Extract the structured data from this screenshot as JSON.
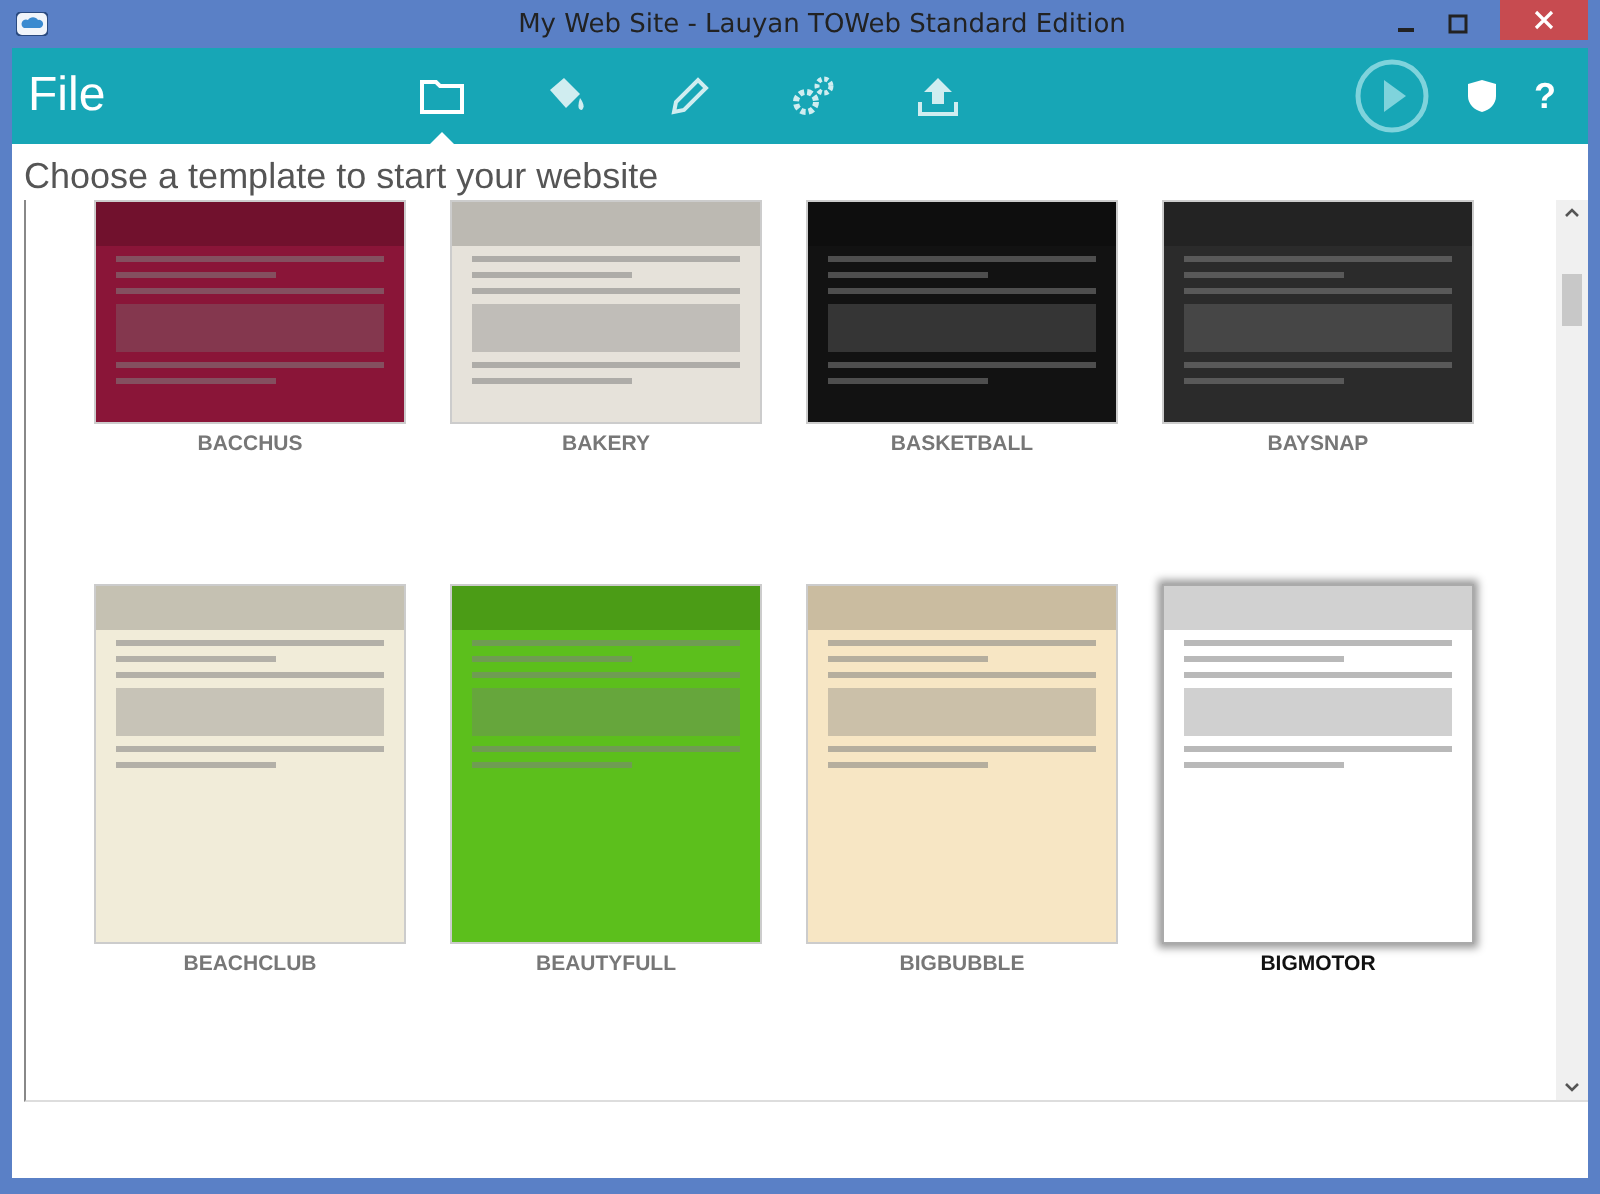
{
  "window": {
    "title": "My Web Site - Lauyan TOWeb Standard Edition"
  },
  "toolbar": {
    "menu_label": "File",
    "tools": [
      {
        "kind": "folder",
        "selected": true
      },
      {
        "kind": "bucket",
        "selected": false
      },
      {
        "kind": "pencil",
        "selected": false
      },
      {
        "kind": "gears",
        "selected": false
      },
      {
        "kind": "upload",
        "selected": false
      }
    ],
    "help_label": "?"
  },
  "heading": "Choose a template to start your website",
  "templates": [
    {
      "name": "BACCHUS",
      "selected": false,
      "color": "#8a1538"
    },
    {
      "name": "BAKERY",
      "selected": false,
      "color": "#e6e2da"
    },
    {
      "name": "BASKETBALL",
      "selected": false,
      "color": "#121212"
    },
    {
      "name": "BAYSNAP",
      "selected": false,
      "color": "#2b2b2b"
    },
    {
      "name": "BEACHCLUB",
      "selected": false,
      "color": "#f1ecd9"
    },
    {
      "name": "BEAUTYFULL",
      "selected": false,
      "color": "#5cbf1c"
    },
    {
      "name": "BIGBUBBLE",
      "selected": false,
      "color": "#f7e6c4"
    },
    {
      "name": "BIGMOTOR",
      "selected": true,
      "color": "#ffffff"
    }
  ]
}
